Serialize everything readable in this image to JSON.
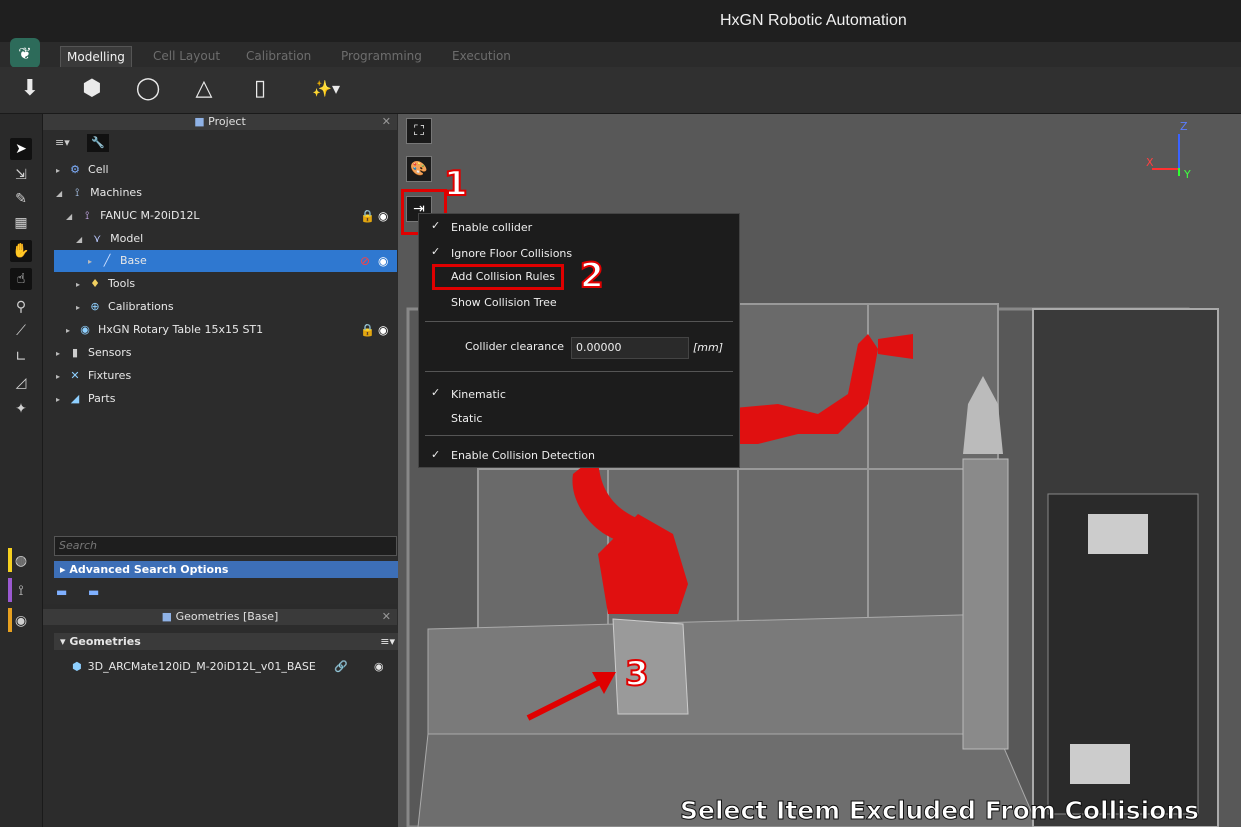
{
  "app": {
    "title": "HxGN Robotic Automation"
  },
  "tabs": [
    {
      "label": "Modelling",
      "active": true
    },
    {
      "label": "Cell Layout"
    },
    {
      "label": "Calibration"
    },
    {
      "label": "Programming"
    },
    {
      "label": "Execution"
    }
  ],
  "project_panel": {
    "title": "Project",
    "tree": [
      {
        "label": "Cell",
        "icon": "cell-icon"
      },
      {
        "label": "Machines",
        "icon": "robot-icon"
      },
      {
        "label": "FANUC M-20iD12L",
        "icon": "robot-arm-icon"
      },
      {
        "label": "Model",
        "icon": "model-icon"
      },
      {
        "label": "Base",
        "icon": "pen-icon",
        "selected": true
      },
      {
        "label": "Tools",
        "icon": "tool-icon"
      },
      {
        "label": "Calibrations",
        "icon": "calibration-icon"
      },
      {
        "label": "HxGN  Rotary Table 15x15 ST1",
        "icon": "rotary-table-icon"
      },
      {
        "label": "Sensors",
        "icon": "sensor-icon"
      },
      {
        "label": "Fixtures",
        "icon": "fixture-icon"
      },
      {
        "label": "Parts",
        "icon": "part-icon"
      }
    ],
    "search_placeholder": "Search",
    "advanced_search": "Advanced Search Options"
  },
  "geometries_panel": {
    "title": "Geometries [Base]",
    "section": "Geometries",
    "item": "3D_ARCMate120iD_M-20iD12L_v01_BASE"
  },
  "context_menu": {
    "enable_collider": "Enable collider",
    "ignore_floor": "Ignore Floor Collisions",
    "add_rules": "Add Collision Rules",
    "show_tree": "Show Collision Tree",
    "clearance_label": "Collider clearance",
    "clearance_value": "0.00000",
    "clearance_unit": "[mm]",
    "kinematic": "Kinematic",
    "static": "Static",
    "enable_detection": "Enable Collision Detection"
  },
  "annotations": {
    "step1": "1",
    "step2": "2",
    "step3": "3",
    "caption": "Select Item Excluded From Collisions"
  },
  "axes": {
    "x": "X",
    "y": "Y",
    "z": "Z"
  },
  "colors": {
    "accent": "#2f78d0",
    "highlight": "#e00000",
    "robot": "#e01010"
  }
}
